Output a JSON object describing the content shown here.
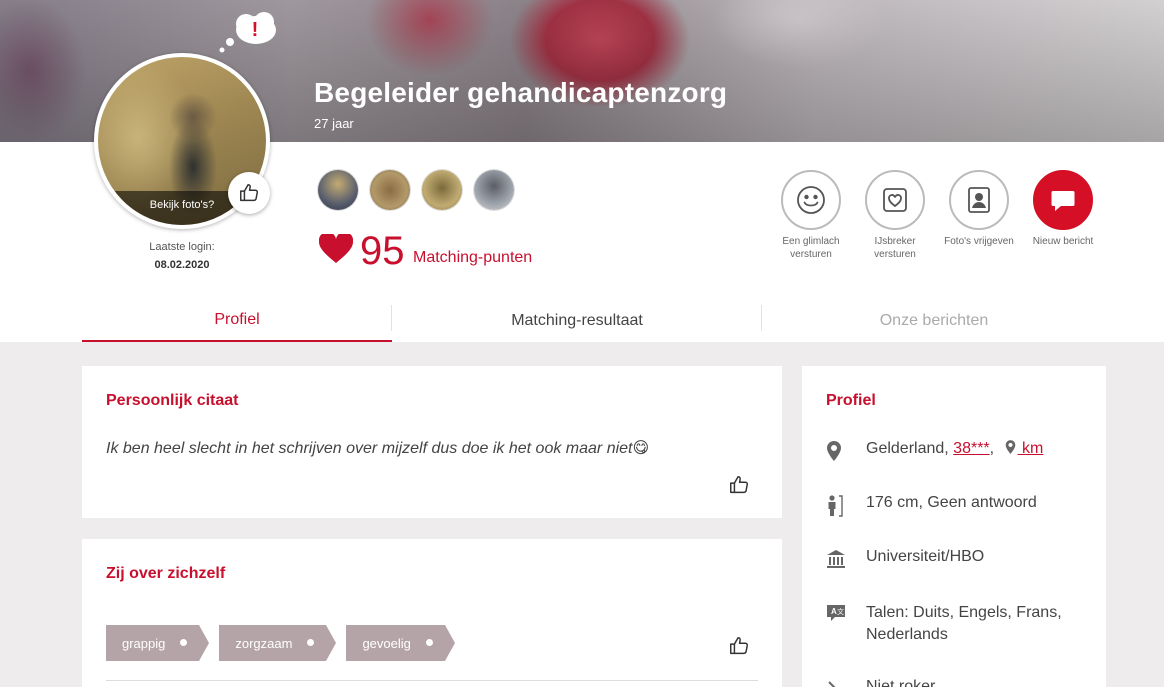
{
  "hero": {
    "title": "Begeleider gehandicaptenzorg",
    "age": "27 jaar"
  },
  "avatar": {
    "label": "Bekijk foto's?",
    "last_login_label": "Laatste login:",
    "last_login_date": "08.02.2020"
  },
  "matching": {
    "score": "95",
    "label": "Matching-punten"
  },
  "actions": [
    {
      "line1": "Een glimlach",
      "line2": "versturen"
    },
    {
      "line1": "IJsbreker",
      "line2": "versturen"
    },
    {
      "line1": "Foto's vrijgeven",
      "line2": ""
    },
    {
      "line1": "Nieuw bericht",
      "line2": ""
    }
  ],
  "tabs": [
    "Profiel",
    "Matching-resultaat",
    "Onze berichten"
  ],
  "quote_card": {
    "title": "Persoonlijk citaat",
    "text": "Ik ben heel slecht in het schrijven over mijzelf dus doe ik het ook maar niet😋"
  },
  "about_card": {
    "title": "Zij over zichzelf",
    "tags": [
      "grappig",
      "zorgzaam",
      "gevoelig"
    ]
  },
  "profile_card": {
    "title": "Profiel",
    "location_text": "Gelderland, ",
    "postcode": "38***",
    "comma": ",",
    "distance": " km",
    "height": "176 cm, Geen antwoord",
    "education": "Universiteit/HBO",
    "languages": "Talen: Duits, Engels, Frans, Nederlands",
    "smoking": "Niet roker"
  },
  "colors": {
    "accent": "#c8102e",
    "tag": "#b4a4a7",
    "background": "#efeced"
  }
}
